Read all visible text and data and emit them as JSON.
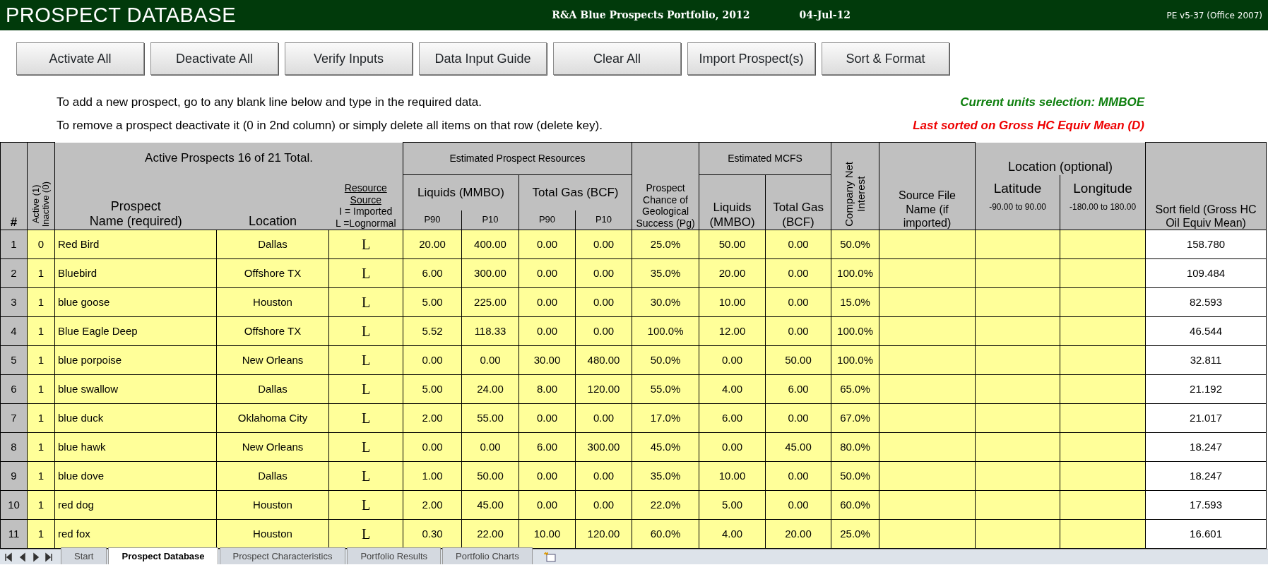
{
  "title_bar": {
    "title": "PROSPECT DATABASE",
    "portfolio": "R&A Blue Prospects Portfolio, 2012",
    "date": "04-Jul-12",
    "version": "PE v5-37 (Office 2007)"
  },
  "buttons": [
    "Activate All",
    "Deactivate All",
    "Verify Inputs",
    "Data Input Guide",
    "Clear All",
    "Import Prospect(s)",
    "Sort & Format"
  ],
  "instructions": [
    "To add a new prospect, go to any blank line below and type in the required data.",
    "To remove a prospect deactivate it (0 in 2nd column) or simply delete all items on that row (delete key)."
  ],
  "units_note": "Current units selection: MMBOE",
  "sort_note": "Last sorted on Gross HC Equiv Mean (D)",
  "table": {
    "headers": {
      "num": "#",
      "active": [
        "Active (1)",
        "Inactive (0)"
      ],
      "summary": "Active Prospects 16 of 21 Total.",
      "name": [
        "Prospect",
        "Name (required)"
      ],
      "location": "Location",
      "resource": [
        {
          "text": "Resource",
          "underlined": true
        },
        {
          "text": "Source",
          "underlined": true
        },
        {
          "text": "I = Imported",
          "underlined": false
        },
        {
          "text": "L =Lognormal",
          "underlined": false
        }
      ],
      "est_resources": "Estimated Prospect Resources",
      "liquids": "Liquids (MMBO)",
      "gas": "Total Gas (BCF)",
      "p_labels": [
        "P90",
        "P10",
        "P90",
        "P10"
      ],
      "pg": [
        "Prospect",
        "Chance of",
        "Geological",
        "Success (Pg)"
      ],
      "mcfs": "Estimated MCFS",
      "mcfs_liquids": [
        "Liquids",
        "(MMBO)"
      ],
      "mcfs_gas": [
        "Total Gas",
        "(BCF)"
      ],
      "cni": [
        "Company Net",
        "Interest"
      ],
      "source_file": [
        "Source File",
        "Name (if",
        "imported)"
      ],
      "loc_optional": "Location (optional)",
      "latitude": "Latitude",
      "lat_range": "-90.00 to 90.00",
      "longitude": "Longitude",
      "lon_range": "-180.00 to 180.00",
      "sort_field": [
        "Sort field (Gross HC",
        "Oil Equiv Mean)"
      ]
    },
    "rows": [
      {
        "num": "1",
        "active": "0",
        "name": "Red Bird",
        "location": "Dallas",
        "source": "L",
        "values": [
          "20.00",
          "400.00",
          "0.00",
          "0.00",
          "25.0%",
          "50.00",
          "0.00",
          "50.0%"
        ],
        "sort": "158.780"
      },
      {
        "num": "2",
        "active": "1",
        "name": "Bluebird",
        "location": "Offshore TX",
        "source": "L",
        "values": [
          "6.00",
          "300.00",
          "0.00",
          "0.00",
          "35.0%",
          "20.00",
          "0.00",
          "100.0%"
        ],
        "sort": "109.484"
      },
      {
        "num": "3",
        "active": "1",
        "name": "blue goose",
        "location": "Houston",
        "source": "L",
        "values": [
          "5.00",
          "225.00",
          "0.00",
          "0.00",
          "30.0%",
          "10.00",
          "0.00",
          "15.0%"
        ],
        "sort": "82.593"
      },
      {
        "num": "4",
        "active": "1",
        "name": "Blue Eagle Deep",
        "location": "Offshore TX",
        "source": "L",
        "values": [
          "5.52",
          "118.33",
          "0.00",
          "0.00",
          "100.0%",
          "12.00",
          "0.00",
          "100.0%"
        ],
        "sort": "46.544"
      },
      {
        "num": "5",
        "active": "1",
        "name": "blue porpoise",
        "location": "New Orleans",
        "source": "L",
        "values": [
          "0.00",
          "0.00",
          "30.00",
          "480.00",
          "50.0%",
          "0.00",
          "50.00",
          "100.0%"
        ],
        "sort": "32.811"
      },
      {
        "num": "6",
        "active": "1",
        "name": "blue swallow",
        "location": "Dallas",
        "source": "L",
        "values": [
          "5.00",
          "24.00",
          "8.00",
          "120.00",
          "55.0%",
          "4.00",
          "6.00",
          "65.0%"
        ],
        "sort": "21.192"
      },
      {
        "num": "7",
        "active": "1",
        "name": "blue duck",
        "location": "Oklahoma City",
        "source": "L",
        "values": [
          "2.00",
          "55.00",
          "0.00",
          "0.00",
          "17.0%",
          "6.00",
          "0.00",
          "67.0%"
        ],
        "sort": "21.017"
      },
      {
        "num": "8",
        "active": "1",
        "name": "blue hawk",
        "location": "New Orleans",
        "source": "L",
        "values": [
          "0.00",
          "0.00",
          "6.00",
          "300.00",
          "45.0%",
          "0.00",
          "45.00",
          "80.0%"
        ],
        "sort": "18.247"
      },
      {
        "num": "9",
        "active": "1",
        "name": "blue dove",
        "location": "Dallas",
        "source": "L",
        "values": [
          "1.00",
          "50.00",
          "0.00",
          "0.00",
          "35.0%",
          "10.00",
          "0.00",
          "50.0%"
        ],
        "sort": "18.247"
      },
      {
        "num": "10",
        "active": "1",
        "name": "red dog",
        "location": "Houston",
        "source": "L",
        "values": [
          "2.00",
          "45.00",
          "0.00",
          "0.00",
          "22.0%",
          "5.00",
          "0.00",
          "60.0%"
        ],
        "sort": "17.593"
      },
      {
        "num": "11",
        "active": "1",
        "name": "red fox",
        "location": "Houston",
        "source": "L",
        "values": [
          "0.30",
          "22.00",
          "10.00",
          "120.00",
          "60.0%",
          "4.00",
          "20.00",
          "25.0%"
        ],
        "sort": "16.601"
      }
    ]
  },
  "sheet_tabs": [
    {
      "label": "Start",
      "selected": false
    },
    {
      "label": "Prospect Database",
      "selected": true
    },
    {
      "label": "Prospect Characteristics",
      "selected": false
    },
    {
      "label": "Portfolio Results",
      "selected": false
    },
    {
      "label": "Portfolio Charts",
      "selected": false
    }
  ]
}
